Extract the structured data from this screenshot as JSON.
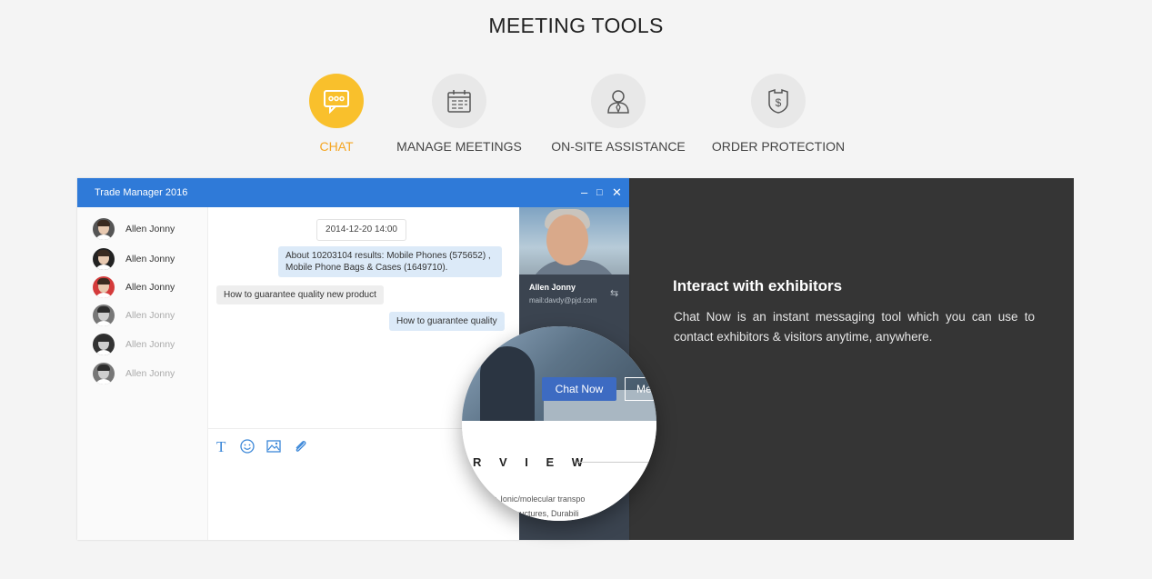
{
  "page_title": "MEETING TOOLS",
  "tabs": [
    {
      "label": "CHAT",
      "icon": "chat-bubble-icon",
      "active": true
    },
    {
      "label": "MANAGE MEETINGS",
      "icon": "calendar-icon",
      "active": false
    },
    {
      "label": "ON-SITE ASSISTANCE",
      "icon": "assistant-person-icon",
      "active": false
    },
    {
      "label": "ORDER PROTECTION",
      "icon": "shield-dollar-icon",
      "active": false
    }
  ],
  "window": {
    "title": "Trade Manager 2016",
    "controls": {
      "minimize": "–",
      "maximize": "□",
      "close": "✕"
    }
  },
  "contacts": [
    {
      "name": "Allen Jonny",
      "online": true
    },
    {
      "name": "Allen Jonny",
      "online": true
    },
    {
      "name": "Allen Jonny",
      "online": true
    },
    {
      "name": "Allen Jonny",
      "online": false
    },
    {
      "name": "Allen Jonny",
      "online": false
    },
    {
      "name": "Allen Jonny",
      "online": false
    }
  ],
  "chat": {
    "timestamp": "2014-12-20  14:00",
    "messages": [
      {
        "from": "me",
        "line1": "About 10203104 results: Mobile Phones (575652) ,",
        "line2": "Mobile Phone Bags & Cases (1649710)."
      },
      {
        "from": "them",
        "line1": "How to guarantee quality new product"
      },
      {
        "from": "me",
        "line1": "How to guarantee quality"
      }
    ],
    "toolbar": [
      "text-format-icon",
      "emoji-icon",
      "image-icon",
      "attachment-icon"
    ]
  },
  "profile": {
    "name": "Allen Jonny",
    "email": "mail:davdy@pjd.com",
    "swap_icon": "⇆"
  },
  "magnifier": {
    "primary_button": "Chat Now",
    "secondary_button": "Me",
    "heading_fragment": "R V I E W",
    "text_line1": "bility, Ionic/molecular transpo",
    "text_line2": "tructures, Durabili"
  },
  "info": {
    "title": "Interact with exhibitors",
    "text": "Chat Now is an instant messaging tool which you can use to contact exhibitors & visitors anytime, anywhere."
  },
  "colors": {
    "accent": "#f9c02c",
    "accent_text": "#f5a623",
    "window_blue": "#2f7ad8",
    "panel_dark": "#353535",
    "button_blue": "#3d6bc2"
  }
}
